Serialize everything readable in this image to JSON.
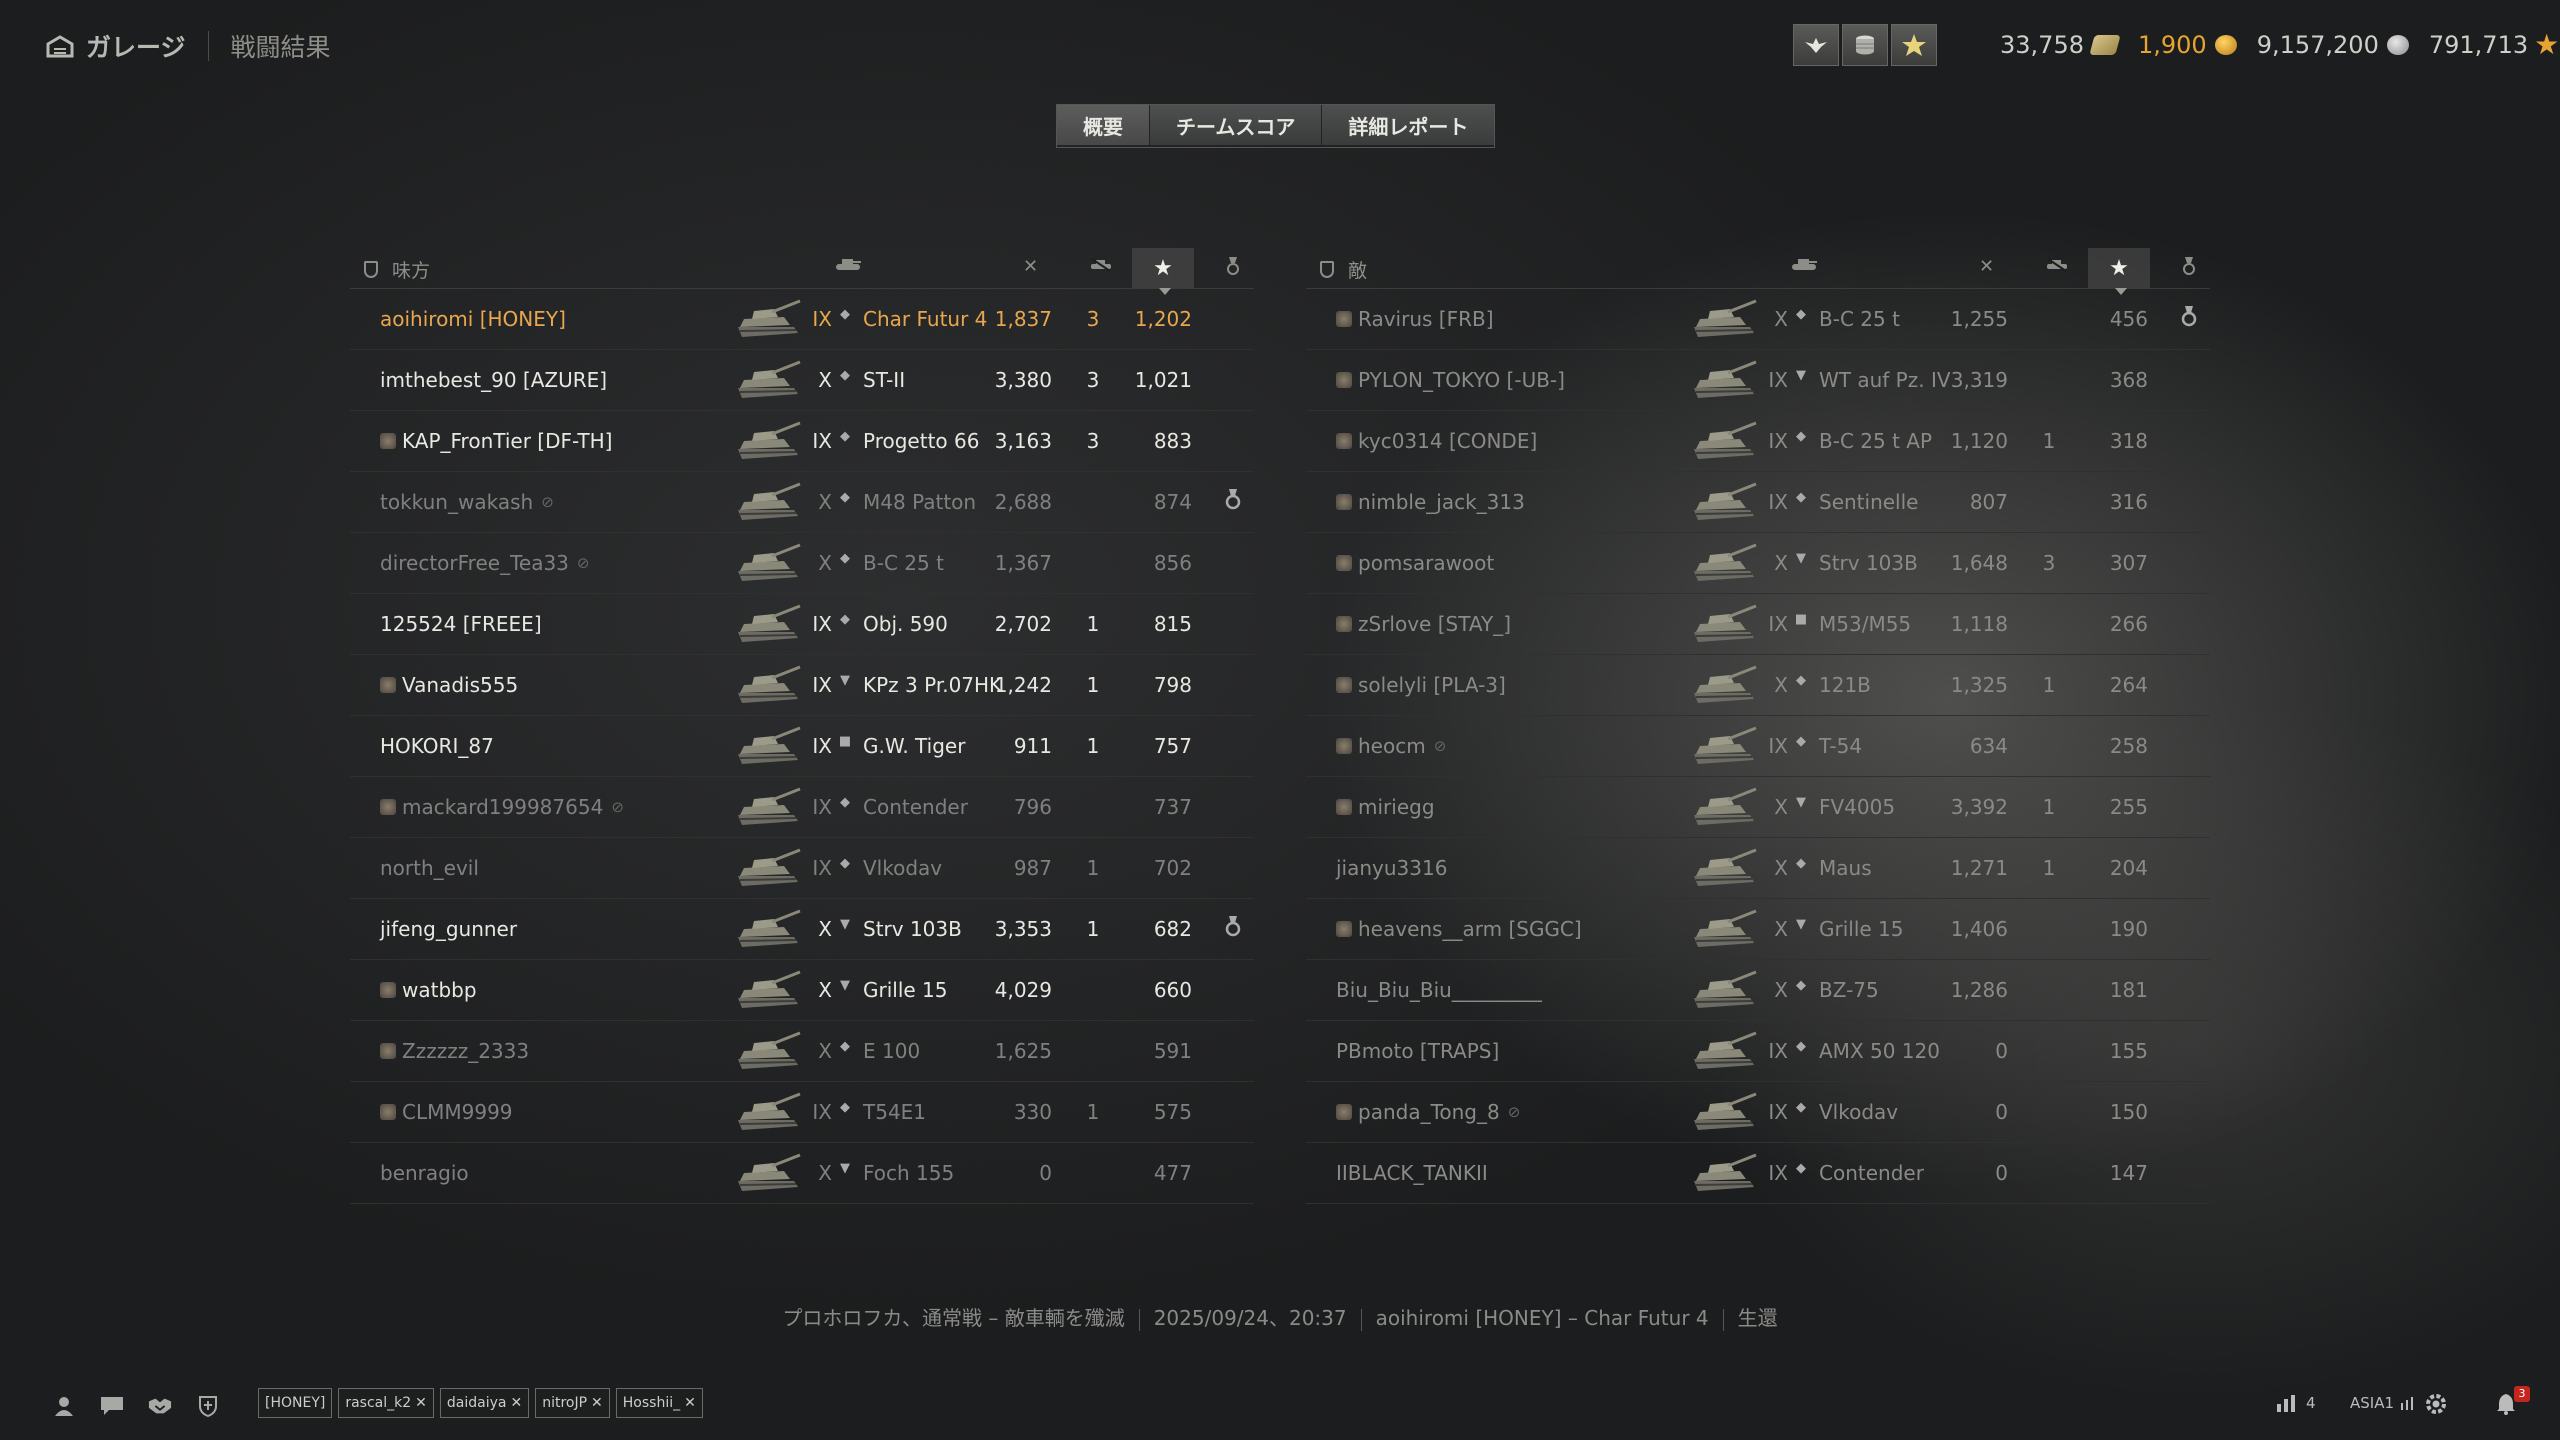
{
  "nav": {
    "garage_label": "ガレージ",
    "current_label": "戦闘結果"
  },
  "currencies": {
    "bonds": "33,758",
    "gold": "1,900",
    "credits": "9,157,200",
    "free_xp": "791,713"
  },
  "tabs": [
    {
      "label": "概要"
    },
    {
      "label": "チームスコア"
    },
    {
      "label": "詳細レポート"
    }
  ],
  "ally": {
    "title": "味方",
    "rows": [
      {
        "name": "aoihiromi [HONEY]",
        "tier": "IX",
        "class": "lt",
        "tank": "Char Futur 4",
        "damage": "1,837",
        "kills": "3",
        "xp": "1,202",
        "state": "me",
        "medal": false,
        "hidden": false,
        "clan_icon": false
      },
      {
        "name": "imthebest_90 [AZURE]",
        "tier": "X",
        "class": "lt",
        "tank": "ST-II",
        "damage": "3,380",
        "kills": "3",
        "xp": "1,021",
        "state": "alive",
        "medal": false,
        "hidden": false,
        "clan_icon": false
      },
      {
        "name": "KAP_FronTier [DF-TH]",
        "tier": "IX",
        "class": "lt",
        "tank": "Progetto 66",
        "damage": "3,163",
        "kills": "3",
        "xp": "883",
        "state": "alive",
        "medal": false,
        "hidden": false,
        "clan_icon": true
      },
      {
        "name": "tokkun_wakash",
        "tier": "X",
        "class": "lt",
        "tank": "M48 Patton",
        "damage": "2,688",
        "kills": "",
        "xp": "874",
        "state": "dim",
        "medal": true,
        "hidden": true,
        "clan_icon": false
      },
      {
        "name": "directorFree_Tea33",
        "tier": "X",
        "class": "lt",
        "tank": "B-C 25 t",
        "damage": "1,367",
        "kills": "",
        "xp": "856",
        "state": "dim",
        "medal": false,
        "hidden": true,
        "clan_icon": false
      },
      {
        "name": "125524 [FREEE]",
        "tier": "IX",
        "class": "lt",
        "tank": "Obj. 590",
        "damage": "2,702",
        "kills": "1",
        "xp": "815",
        "state": "alive",
        "medal": false,
        "hidden": false,
        "clan_icon": false
      },
      {
        "name": "Vanadis555",
        "tier": "IX",
        "class": "td",
        "tank": "KPz 3 Pr.07HK",
        "damage": "1,242",
        "kills": "1",
        "xp": "798",
        "state": "alive",
        "medal": false,
        "hidden": false,
        "clan_icon": true
      },
      {
        "name": "HOKORI_87",
        "tier": "IX",
        "class": "spg",
        "tank": "G.W. Tiger",
        "damage": "911",
        "kills": "1",
        "xp": "757",
        "state": "alive",
        "medal": false,
        "hidden": false,
        "clan_icon": false
      },
      {
        "name": "mackard199987654",
        "tier": "IX",
        "class": "lt",
        "tank": "Contender",
        "damage": "796",
        "kills": "",
        "xp": "737",
        "state": "dim",
        "medal": false,
        "hidden": true,
        "clan_icon": true
      },
      {
        "name": "north_evil",
        "tier": "IX",
        "class": "lt",
        "tank": "Vlkodav",
        "damage": "987",
        "kills": "1",
        "xp": "702",
        "state": "dim",
        "medal": false,
        "hidden": false,
        "clan_icon": false
      },
      {
        "name": "jifeng_gunner",
        "tier": "X",
        "class": "td",
        "tank": "Strv 103B",
        "damage": "3,353",
        "kills": "1",
        "xp": "682",
        "state": "alive",
        "medal": true,
        "hidden": false,
        "clan_icon": false
      },
      {
        "name": "watbbp",
        "tier": "X",
        "class": "td",
        "tank": "Grille 15",
        "damage": "4,029",
        "kills": "",
        "xp": "660",
        "state": "alive",
        "medal": false,
        "hidden": false,
        "clan_icon": true
      },
      {
        "name": "Zzzzzz_2333",
        "tier": "X",
        "class": "lt",
        "tank": "E 100",
        "damage": "1,625",
        "kills": "",
        "xp": "591",
        "state": "dim",
        "medal": false,
        "hidden": false,
        "clan_icon": true
      },
      {
        "name": "CLMM9999",
        "tier": "IX",
        "class": "lt",
        "tank": "T54E1",
        "damage": "330",
        "kills": "1",
        "xp": "575",
        "state": "dim",
        "medal": false,
        "hidden": false,
        "clan_icon": true
      },
      {
        "name": "benragio",
        "tier": "X",
        "class": "td",
        "tank": "Foch 155",
        "damage": "0",
        "kills": "",
        "xp": "477",
        "state": "dim",
        "medal": false,
        "hidden": false,
        "clan_icon": false
      }
    ]
  },
  "enemy": {
    "title": "敵",
    "rows": [
      {
        "name": "Ravirus [FRB]",
        "tier": "X",
        "class": "lt",
        "tank": "B-C 25 t",
        "damage": "1,255",
        "kills": "",
        "xp": "456",
        "state": "dim",
        "medal": true,
        "hidden": false,
        "clan_icon": true
      },
      {
        "name": "PYLON_TOKYO [-UB-]",
        "tier": "IX",
        "class": "td",
        "tank": "WT auf Pz. IV",
        "damage": "3,319",
        "kills": "",
        "xp": "368",
        "state": "dim",
        "medal": false,
        "hidden": false,
        "clan_icon": true
      },
      {
        "name": "kyc0314 [CONDE]",
        "tier": "IX",
        "class": "lt",
        "tank": "B-C 25 t AP",
        "damage": "1,120",
        "kills": "1",
        "xp": "318",
        "state": "dim",
        "medal": false,
        "hidden": false,
        "clan_icon": true
      },
      {
        "name": "nimble_jack_313",
        "tier": "IX",
        "class": "lt",
        "tank": "Sentinelle",
        "damage": "807",
        "kills": "",
        "xp": "316",
        "state": "dim",
        "medal": false,
        "hidden": false,
        "clan_icon": true
      },
      {
        "name": "pomsarawoot",
        "tier": "X",
        "class": "td",
        "tank": "Strv 103B",
        "damage": "1,648",
        "kills": "3",
        "xp": "307",
        "state": "dim",
        "medal": false,
        "hidden": false,
        "clan_icon": true
      },
      {
        "name": "zSrlove [STAY_]",
        "tier": "IX",
        "class": "spg",
        "tank": "M53/M55",
        "damage": "1,118",
        "kills": "",
        "xp": "266",
        "state": "dim",
        "medal": false,
        "hidden": false,
        "clan_icon": true
      },
      {
        "name": "solelyli [PLA-3]",
        "tier": "X",
        "class": "lt",
        "tank": "121B",
        "damage": "1,325",
        "kills": "1",
        "xp": "264",
        "state": "dim",
        "medal": false,
        "hidden": false,
        "clan_icon": true
      },
      {
        "name": "heocm",
        "tier": "IX",
        "class": "lt",
        "tank": "T-54",
        "damage": "634",
        "kills": "",
        "xp": "258",
        "state": "dim",
        "medal": false,
        "hidden": true,
        "clan_icon": true
      },
      {
        "name": "miriegg",
        "tier": "X",
        "class": "td",
        "tank": "FV4005",
        "damage": "3,392",
        "kills": "1",
        "xp": "255",
        "state": "dim",
        "medal": false,
        "hidden": false,
        "clan_icon": true
      },
      {
        "name": "jianyu3316",
        "tier": "X",
        "class": "lt",
        "tank": "Maus",
        "damage": "1,271",
        "kills": "1",
        "xp": "204",
        "state": "dim",
        "medal": false,
        "hidden": false,
        "clan_icon": false
      },
      {
        "name": "heavens__arm [SGGC]",
        "tier": "X",
        "class": "td",
        "tank": "Grille 15",
        "damage": "1,406",
        "kills": "",
        "xp": "190",
        "state": "dim",
        "medal": false,
        "hidden": false,
        "clan_icon": true
      },
      {
        "name": "Biu_Biu_Biu_________",
        "tier": "X",
        "class": "lt",
        "tank": "BZ-75",
        "damage": "1,286",
        "kills": "",
        "xp": "181",
        "state": "dim",
        "medal": false,
        "hidden": false,
        "clan_icon": false
      },
      {
        "name": "PBmoto [TRAPS]",
        "tier": "IX",
        "class": "lt",
        "tank": "AMX 50 120",
        "damage": "0",
        "kills": "",
        "xp": "155",
        "state": "dim",
        "medal": false,
        "hidden": false,
        "clan_icon": false
      },
      {
        "name": "panda_Tong_8",
        "tier": "IX",
        "class": "lt",
        "tank": "Vlkodav",
        "damage": "0",
        "kills": "",
        "xp": "150",
        "state": "dim",
        "medal": false,
        "hidden": true,
        "clan_icon": true
      },
      {
        "name": "IIBLACK_TANKII",
        "tier": "IX",
        "class": "lt",
        "tank": "Contender",
        "damage": "0",
        "kills": "",
        "xp": "147",
        "state": "dim",
        "medal": false,
        "hidden": false,
        "clan_icon": false
      }
    ]
  },
  "footer": {
    "map_mode": "プロホロフカ、通常戦 – 敵車輌を殲滅",
    "datetime": "2025/09/24、20:37",
    "player_tank": "aoihiromi [HONEY] – Char Futur 4",
    "status": "生還"
  },
  "bottom": {
    "chips": [
      {
        "label": "[HONEY]",
        "closable": false
      },
      {
        "label": "rascal_k2",
        "closable": true
      },
      {
        "label": "daidaiya",
        "closable": true
      },
      {
        "label": "nitroJP",
        "closable": true
      },
      {
        "label": "Hosshii_",
        "closable": true
      }
    ],
    "online_count": "4",
    "server": "ASIA1",
    "notifications": "3"
  },
  "colors": {
    "accent": "#e8a431",
    "me": "#e8a74e"
  },
  "icons": {
    "class_lt": "◆",
    "class_td": "▼",
    "class_spg": "■"
  }
}
